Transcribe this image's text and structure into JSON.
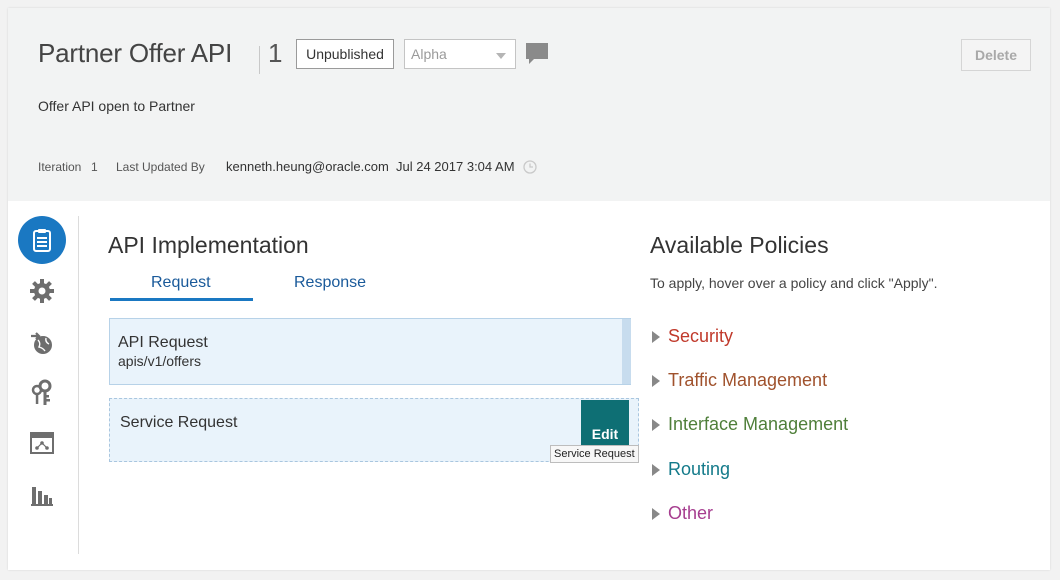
{
  "header": {
    "title": "Partner Offer API",
    "version": "1",
    "status_button": "Unpublished",
    "stage_select": "Alpha",
    "delete_button": "Delete",
    "description": "Offer API open to Partner",
    "iteration_label": "Iteration",
    "iteration_value": "1",
    "updated_by_label": "Last Updated By",
    "updated_by_value": "kenneth.heung@oracle.com",
    "updated_at": "Jul 24 2017 3:04 AM"
  },
  "sidebar": {
    "items": [
      {
        "icon": "clipboard-icon",
        "active": true
      },
      {
        "icon": "gear-icon",
        "active": false
      },
      {
        "icon": "globe-arrow-icon",
        "active": false
      },
      {
        "icon": "keys-icon",
        "active": false
      },
      {
        "icon": "deployment-icon",
        "active": false
      },
      {
        "icon": "bar-chart-icon",
        "active": false
      }
    ]
  },
  "implementation": {
    "title": "API Implementation",
    "tabs": [
      {
        "label": "Request",
        "active": true
      },
      {
        "label": "Response",
        "active": false
      }
    ],
    "api_request": {
      "title": "API Request",
      "path": "apis/v1/offers"
    },
    "service_request": {
      "title": "Service Request",
      "edit_label": "Edit",
      "tooltip": "Service Request"
    }
  },
  "policies": {
    "title": "Available Policies",
    "help": "To apply, hover over a policy and click \"Apply\".",
    "groups": [
      {
        "label": "Security",
        "color": "#c0392b"
      },
      {
        "label": "Traffic Management",
        "color": "#a0522d"
      },
      {
        "label": "Interface Management",
        "color": "#4f7f3a"
      },
      {
        "label": "Routing",
        "color": "#137a8a"
      },
      {
        "label": "Other",
        "color": "#a63d8f"
      }
    ]
  },
  "colors": {
    "accent": "#1a78c2",
    "edit_button": "#0e6f74"
  }
}
